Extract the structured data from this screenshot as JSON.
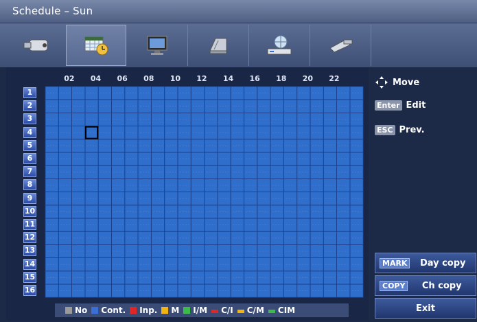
{
  "window": {
    "title": "Schedule – Sun"
  },
  "tabs": [
    {
      "name": "camera-icon"
    },
    {
      "name": "calendar-clock-icon"
    },
    {
      "name": "monitor-icon"
    },
    {
      "name": "hard-disk-icon"
    },
    {
      "name": "network-icon"
    },
    {
      "name": "tools-icon"
    }
  ],
  "grid": {
    "hour_labels": [
      "02",
      "04",
      "06",
      "08",
      "10",
      "12",
      "14",
      "16",
      "18",
      "20",
      "22"
    ],
    "channel_labels": [
      "1",
      "2",
      "3",
      "4",
      "5",
      "6",
      "7",
      "8",
      "9",
      "10",
      "11",
      "12",
      "13",
      "14",
      "15",
      "16"
    ],
    "cell_color": "#2f6ecb",
    "selected_cell": {
      "channel": 4,
      "column": 4
    }
  },
  "legend": [
    {
      "label": "No",
      "color": "#9a9a9a"
    },
    {
      "label": "Cont.",
      "color": "#3b6fd8"
    },
    {
      "label": "Inp.",
      "color": "#e02626"
    },
    {
      "label": "M",
      "color": "#f2b414"
    },
    {
      "label": "I/M",
      "color": "#3bbb4a"
    },
    {
      "label": "C/I",
      "color": "#e02626"
    },
    {
      "label": "C/M",
      "color": "#f2b414"
    },
    {
      "label": "CIM",
      "color": "#3bbb4a"
    }
  ],
  "hints": {
    "move": "Move",
    "enter_key": "Enter",
    "edit": "Edit",
    "esc_key": "ESC",
    "prev": "Prev."
  },
  "buttons": {
    "mark_key": "MARK",
    "day_copy": "Day copy",
    "copy_key": "COPY",
    "ch_copy": "Ch copy",
    "exit": "Exit"
  }
}
